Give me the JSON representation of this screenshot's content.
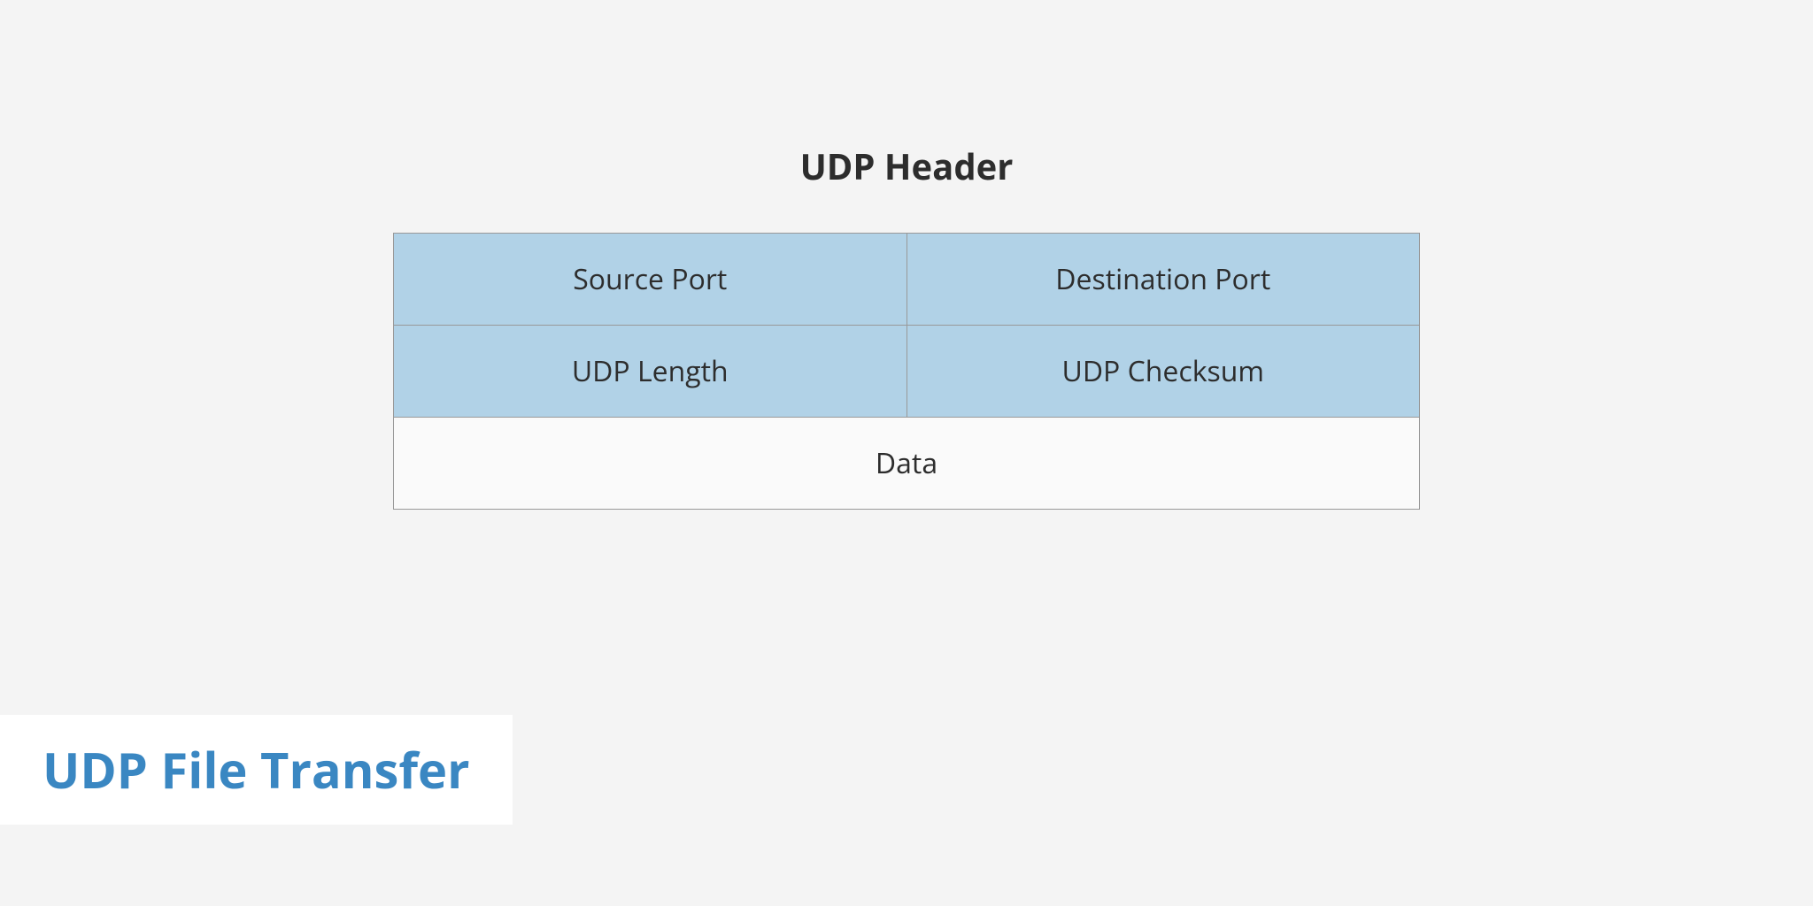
{
  "diagram": {
    "title": "UDP Header",
    "rows": [
      {
        "left": "Source Port",
        "right": "Destination Port"
      },
      {
        "left": "UDP Length",
        "right": "UDP Checksum"
      }
    ],
    "data_label": "Data"
  },
  "caption": "UDP File Transfer"
}
